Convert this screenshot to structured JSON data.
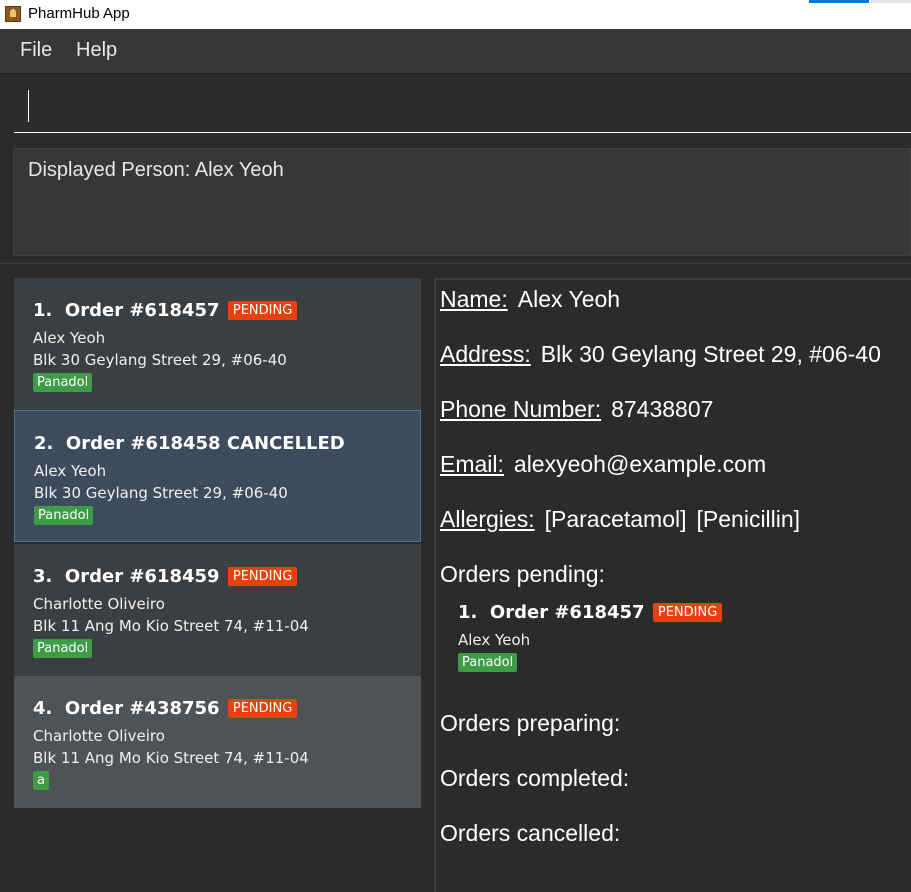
{
  "window": {
    "title": "PharmHub App"
  },
  "menu": {
    "file": "File",
    "help": "Help"
  },
  "command": {
    "value": "",
    "placeholder": ""
  },
  "result": {
    "text": "Displayed Person: Alex Yeoh"
  },
  "orders": [
    {
      "index": "1.",
      "order": "Order #618457",
      "status": "PENDING",
      "status_style": "badge",
      "name": "Alex Yeoh",
      "address": "Blk 30 Geylang Street 29, #06-40",
      "tag": "Panadol"
    },
    {
      "index": "2.",
      "order": "Order #618458",
      "status": "CANCELLED",
      "status_style": "text",
      "name": "Alex Yeoh",
      "address": "Blk 30 Geylang Street 29, #06-40",
      "tag": "Panadol",
      "selected": true
    },
    {
      "index": "3.",
      "order": "Order #618459",
      "status": "PENDING",
      "status_style": "badge",
      "name": "Charlotte Oliveiro",
      "address": "Blk 11 Ang Mo Kio Street 74, #11-04",
      "tag": "Panadol"
    },
    {
      "index": "4.",
      "order": "Order #438756",
      "status": "PENDING",
      "status_style": "badge",
      "name": "Charlotte Oliveiro",
      "address": "Blk 11 Ang Mo Kio Street 74, #11-04",
      "tag": "a"
    }
  ],
  "detail": {
    "name_label": "Name:",
    "name_value": "Alex Yeoh",
    "address_label": "Address:",
    "address_value": "Blk 30 Geylang Street 29, #06-40",
    "phone_label": "Phone Number:",
    "phone_value": "87438807",
    "email_label": "Email:",
    "email_value": "alexyeoh@example.com",
    "allergies_label": "Allergies:",
    "allergies": [
      "[Paracetamol]",
      "[Penicillin]"
    ],
    "pending_heading": "Orders pending:",
    "pending_orders": [
      {
        "index": "1.",
        "order": "Order #618457",
        "status": "PENDING",
        "name": "Alex Yeoh",
        "tag": "Panadol"
      }
    ],
    "preparing_heading": "Orders preparing:",
    "completed_heading": "Orders completed:",
    "cancelled_heading": "Orders cancelled:"
  },
  "colors": {
    "background": "#2b2b2b",
    "pending_badge": "#e6420f",
    "tag_green": "#3e9b46",
    "selected_card": "#3e4b5c",
    "selected_border": "#3e7b91"
  },
  "icons": {
    "app": "pharmhub-app-icon"
  }
}
